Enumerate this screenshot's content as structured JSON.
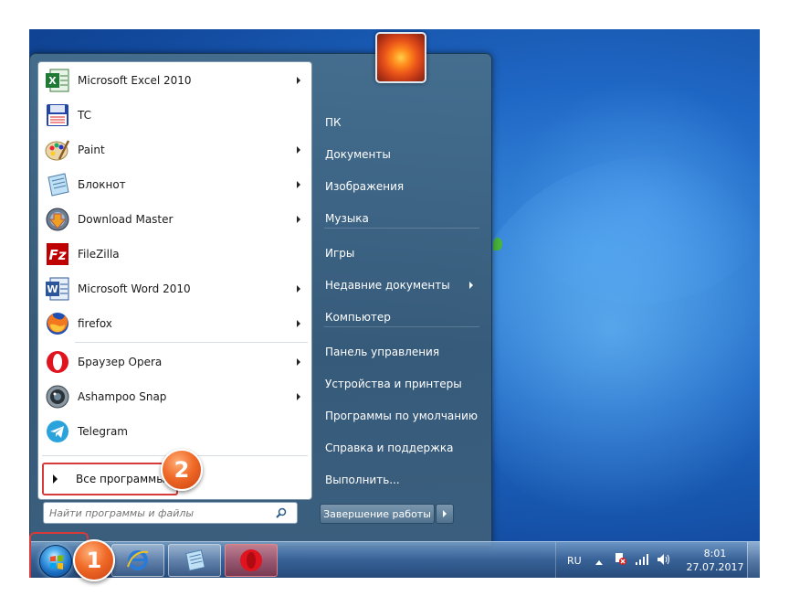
{
  "start_menu": {
    "programs": [
      {
        "label": "Microsoft Excel 2010",
        "icon": "excel-icon",
        "has_submenu": true
      },
      {
        "label": "TC",
        "icon": "total-commander-icon",
        "has_submenu": false
      },
      {
        "label": "Paint",
        "icon": "paint-icon",
        "has_submenu": true
      },
      {
        "label": "Блокнот",
        "icon": "notepad-icon",
        "has_submenu": true
      },
      {
        "label": "Download Master",
        "icon": "download-master-icon",
        "has_submenu": true
      },
      {
        "label": "FileZilla",
        "icon": "filezilla-icon",
        "has_submenu": false
      },
      {
        "label": "Microsoft Word 2010",
        "icon": "word-icon",
        "has_submenu": true
      },
      {
        "label": "firefox",
        "icon": "firefox-icon",
        "has_submenu": true
      },
      {
        "label": "Браузер Opera",
        "icon": "opera-icon",
        "has_submenu": true
      },
      {
        "label": "Ashampoo Snap",
        "icon": "ashampoo-snap-icon",
        "has_submenu": true
      },
      {
        "label": "Telegram",
        "icon": "telegram-icon",
        "has_submenu": false
      }
    ],
    "all_programs_label": "Все программы",
    "search_placeholder": "Найти программы и файлы",
    "right_items": [
      {
        "label": "ПК",
        "has_submenu": false
      },
      {
        "label": "Документы",
        "has_submenu": false
      },
      {
        "label": "Изображения",
        "has_submenu": false
      },
      {
        "label": "Музыка",
        "has_submenu": false
      },
      {
        "label": "Игры",
        "has_submenu": false
      },
      {
        "label": "Недавние документы",
        "has_submenu": true
      },
      {
        "label": "Компьютер",
        "has_submenu": false
      },
      {
        "label": "Панель управления",
        "has_submenu": false
      },
      {
        "label": "Устройства и принтеры",
        "has_submenu": false
      },
      {
        "label": "Программы по умолчанию",
        "has_submenu": false
      },
      {
        "label": "Справка и поддержка",
        "has_submenu": false
      },
      {
        "label": "Выполнить...",
        "has_submenu": false
      }
    ],
    "shutdown_label": "Завершение работы"
  },
  "taskbar": {
    "pinned": [
      "internet-explorer-icon",
      "notepad-icon",
      "opera-icon"
    ],
    "tray": {
      "language": "RU",
      "time": "8:01",
      "date": "27.07.2017"
    }
  },
  "annotations": {
    "step1": "1",
    "step2": "2"
  },
  "colors": {
    "highlight_red": "#d63a3a",
    "badge_orange": "#f06a28"
  }
}
